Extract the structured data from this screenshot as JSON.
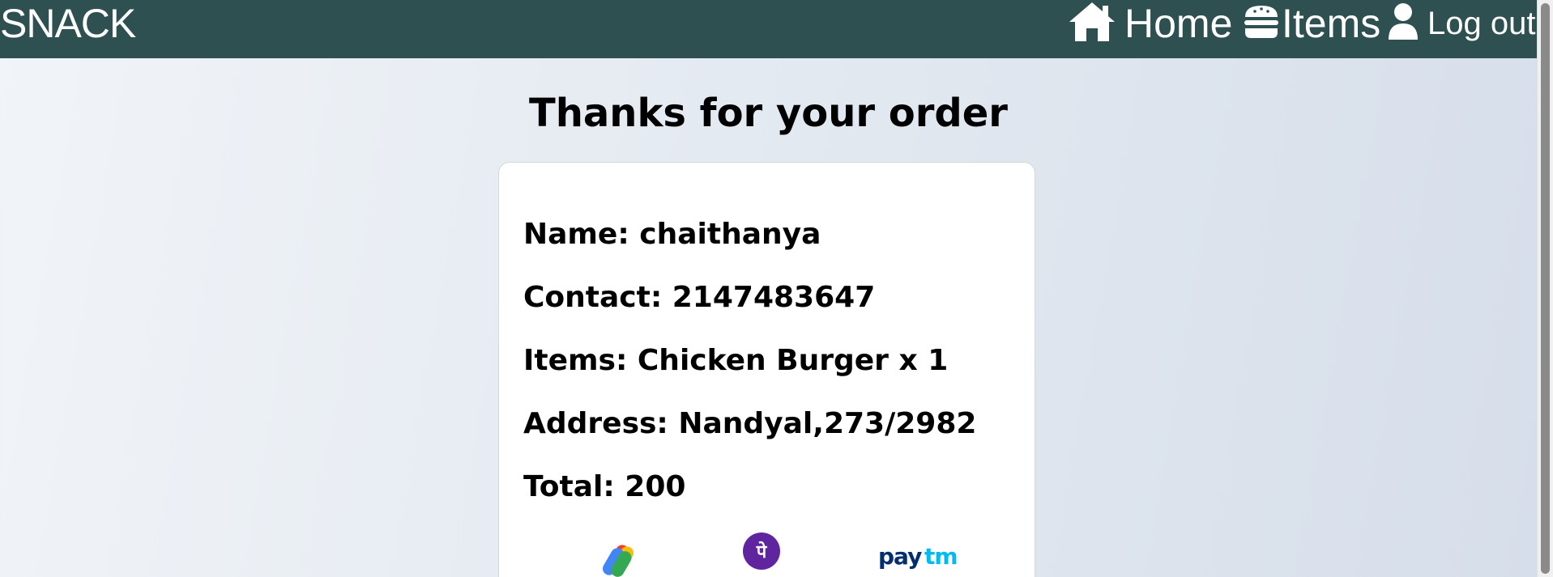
{
  "nav": {
    "brand": "SNACK",
    "links": [
      {
        "label": "Home",
        "icon": "home-icon"
      },
      {
        "label": "Items",
        "icon": "burger-icon"
      },
      {
        "label": "Log out",
        "icon": "user-icon"
      }
    ]
  },
  "page": {
    "title": "Thanks for your order"
  },
  "order": {
    "name": "Name: chaithanya",
    "contact": "Contact: 2147483647",
    "items": "Items: Chicken Burger x 1",
    "address": "Address: Nandyal,273/2982",
    "total": "Total: 200"
  },
  "payments": [
    {
      "name": "Google Pay",
      "icon": "google-pay-icon"
    },
    {
      "name": "PhonePe",
      "icon": "phonepe-icon",
      "glyph": "पे"
    },
    {
      "name": "Paytm",
      "icon": "paytm-icon",
      "wordmark_a": "pay",
      "wordmark_b": "tm"
    }
  ],
  "colors": {
    "navbar": "#2f5050",
    "phonepe": "#5f259f",
    "paytm_dark": "#002e6e",
    "paytm_light": "#00baf2"
  }
}
